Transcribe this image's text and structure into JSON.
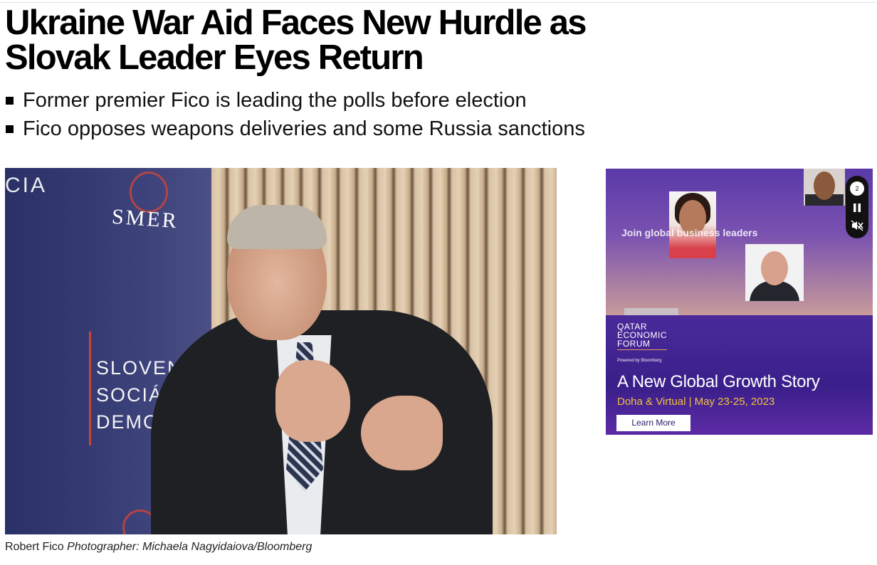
{
  "article": {
    "headline_line1": "Ukraine War Aid Faces New Hurdle as",
    "headline_line2": "Slovak Leader Eyes Return",
    "bullets": [
      "Former premier Fico is leading the polls before election",
      "Fico opposes weapons deliveries and some Russia sanctions"
    ],
    "photo": {
      "sign_cia": "CIA",
      "sign_smer": "SMER",
      "sign_party": [
        "SLOVEN",
        "SOCIÁL",
        "DEMOK"
      ]
    },
    "caption": {
      "subject": "Robert Fico",
      "credit": "Photographer: Michaela Nagyidaiova/Bloomberg"
    }
  },
  "ad": {
    "overlay_text": "Join global business leaders",
    "logo_lines": [
      "QATAR",
      "ECONOMIC",
      "FORUM"
    ],
    "powered_by": "Powered by Bloomberg",
    "tagline": "A New Global Growth Story",
    "dates": "Doha & Virtual | May 23-25, 2023",
    "cta_label": "Learn More",
    "slide_counter": "2",
    "controls": [
      "pause-icon",
      "mute-icon"
    ],
    "colors": {
      "accent_gold": "#f2c23e",
      "ad_purple": "#3a1f8a"
    }
  }
}
